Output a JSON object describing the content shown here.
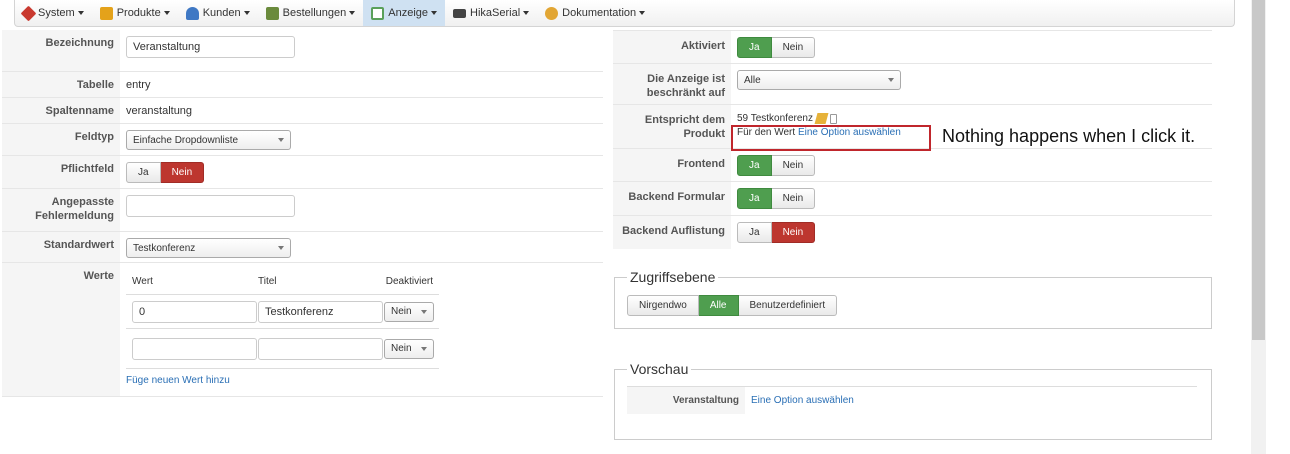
{
  "menu": [
    {
      "label": "System",
      "icon": "wrench-icon",
      "color": "#c9392f"
    },
    {
      "label": "Produkte",
      "icon": "box-icon",
      "color": "#e4a21a"
    },
    {
      "label": "Kunden",
      "icon": "users-icon",
      "color": "#3f78c4"
    },
    {
      "label": "Bestellungen",
      "icon": "list-icon",
      "color": "#6a8a3c"
    },
    {
      "label": "Anzeige",
      "icon": "display-icon",
      "color": "#5aa05a",
      "active": true
    },
    {
      "label": "HikaSerial",
      "icon": "serial-icon",
      "color": "#444444"
    },
    {
      "label": "Dokumentation",
      "icon": "help-icon",
      "color": "#e2a634"
    }
  ],
  "left": {
    "bezeichnung_label": "Bezeichnung",
    "bezeichnung_value": "Veranstaltung",
    "tabelle_label": "Tabelle",
    "tabelle_value": "entry",
    "spaltenname_label": "Spaltenname",
    "spaltenname_value": "veranstaltung",
    "feldtyp_label": "Feldtyp",
    "feldtyp_value": "Einfache Dropdownliste",
    "pflichtfeld_label": "Pflichtfeld",
    "ja": "Ja",
    "nein": "Nein",
    "fehler_label": "Angepasste Fehlermeldung",
    "fehler_value": "",
    "standard_label": "Standardwert",
    "standard_value": "Testkonferenz",
    "werte_label": "Werte",
    "werte_headers": [
      "Wert",
      "Titel",
      "Deaktiviert"
    ],
    "werte_rows": [
      {
        "wert": "0",
        "titel": "Testkonferenz",
        "deakt": "Nein"
      },
      {
        "wert": "",
        "titel": "",
        "deakt": "Nein"
      }
    ],
    "add_value_link": "Füge neuen Wert hinzu"
  },
  "right": {
    "aktiviert_label": "Aktiviert",
    "anzeige_label": "Die Anzeige ist beschränkt auf",
    "anzeige_value": "Alle",
    "produkt_label": "Entspricht dem Produkt",
    "produkt_value": "59 Testkonferenz",
    "produkt_wert_prefix": "Für den Wert",
    "produkt_wert_link": "Eine Option auswählen",
    "frontend_label": "Frontend",
    "backend_formular_label": "Backend Formular",
    "backend_auflistung_label": "Backend Auflistung",
    "ja": "Ja",
    "nein": "Nein"
  },
  "zugriff": {
    "legend": "Zugriffsebene",
    "options": [
      "Nirgendwo",
      "Alle",
      "Benutzerdefiniert"
    ],
    "selected": "Alle"
  },
  "vorschau": {
    "legend": "Vorschau",
    "label": "Veranstaltung",
    "link": "Eine Option auswählen"
  },
  "annotation": "Nothing happens when I click it.",
  "colors": {
    "green": "#4f9e4f",
    "red": "#bd362f",
    "callout": "#c0262c",
    "link": "#2a6fb5"
  }
}
